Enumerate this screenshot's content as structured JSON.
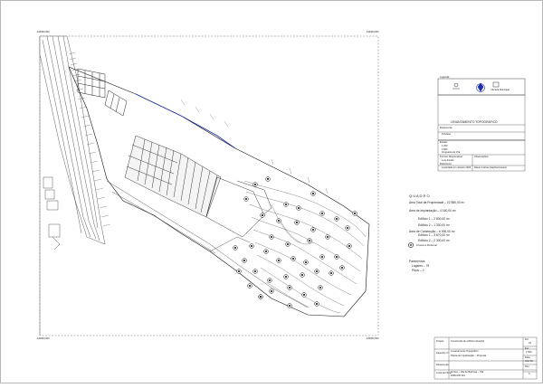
{
  "corner_coords": {
    "top_left": "-140000,000",
    "top_right": "-140000,000",
    "bottom_left": "-140000,000",
    "bottom_right": "-140000,000"
  },
  "legend_box": {
    "title": "Legenda:",
    "logo_caption_left": "",
    "logo_caption_mid": "",
    "logo_caption_right": "Câmara Municipal"
  },
  "plan_title": "LEVANTAMENTO TOPOGRÁFICO",
  "requerente_label": "Requerente:",
  "requerente_value": "Préviaso",
  "escala_label": "Escala:",
  "escala_values": [
    "1:200",
    "1:500",
    "Freguesia de Vila",
    "Concelho de Vila"
  ],
  "responsavel_label": "Técnico Responsável:",
  "responsavel_value": "Luís Aurélio",
  "observacoes_label": "Observações:",
  "ref_label": "Referência:",
  "ref_value": "Levantado em Janeiro 2006",
  "coord_label": "Coordenadas:",
  "coord_value": "Datum Lisboa (Hayford-Gauss)",
  "areas": {
    "title": "Q U A D R O",
    "area_total": "Área Total da Propriedade – 22 880,00 m²",
    "area_impl": "Área de Implantação – 4 160,00 m²",
    "edif1": "Edifício 1 – 2 830,00 m²",
    "edif2": "Edifício 2 – 1 330,00 m²",
    "area_constr": "Área de Construção – 6 000,00 m²",
    "edif1c": "Edifício 1 – 3 670,00 m²",
    "edif2c": "Edifício 2 – 2 330,00 m²"
  },
  "tree_legend": "Árvores a Preservar",
  "pavements": {
    "title": "Pavimentos:",
    "line1": "Lugares – 75",
    "line2": "Pisos – 2"
  },
  "title_block": {
    "projeto_label": "Projeto:",
    "projeto_value": "Construção de edifício industrial",
    "desenho_label": "Desenho nº:",
    "desenho_value1": "Levantamento Topográfico",
    "desenho_value2": "Planta de Implantação – Proposta",
    "requerente_label": "Requerente:",
    "local_label": "Local da Obra:",
    "local_value": "Fontes – Vila de Barbosa – Vila",
    "local_value2": "4490-000 Sbc",
    "escala_label": "Esc.:",
    "escala_value": "1:500",
    "folha_label": "Fol.",
    "folha_value": "01",
    "data_label": "Data",
    "data_value": "Abril 06",
    "rev_label": "Rev.",
    "rev_value": "0"
  }
}
